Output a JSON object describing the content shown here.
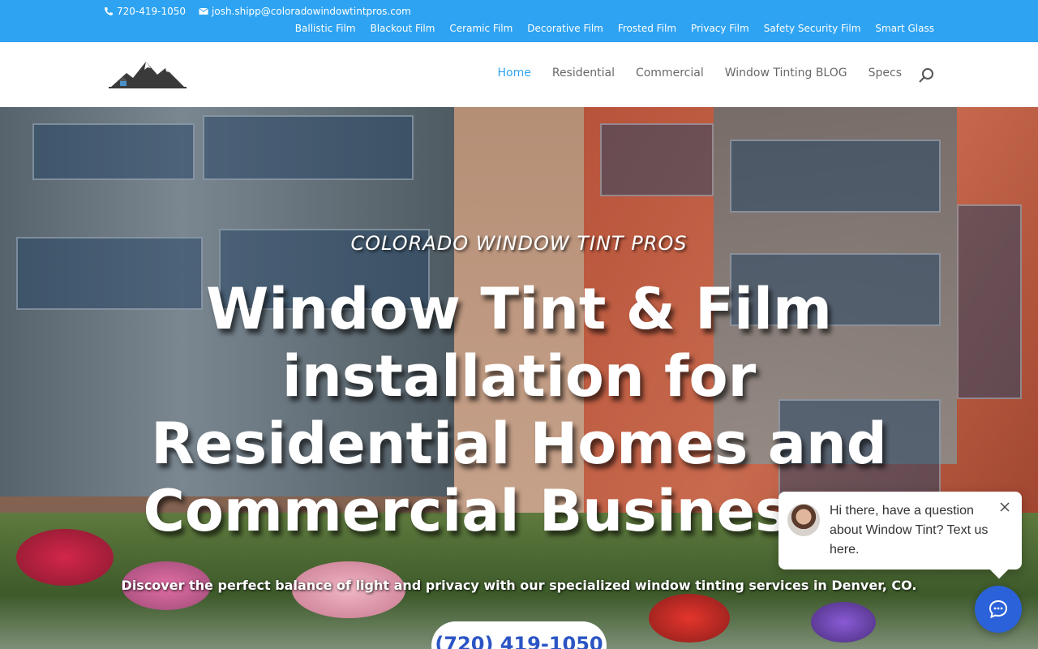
{
  "topbar": {
    "phone": "720-419-1050",
    "email": "josh.shipp@coloradowindowtintpros.com",
    "links": [
      "Ballistic Film",
      "Blackout Film",
      "Ceramic Film",
      "Decorative Film",
      "Frosted Film",
      "Privacy Film",
      "Safety Security Film",
      "Smart Glass"
    ]
  },
  "nav": {
    "items": [
      "Home",
      "Residential",
      "Commercial",
      "Window Tinting BLOG",
      "Specs"
    ],
    "active": "Home"
  },
  "hero": {
    "eyebrow": "COLORADO WINDOW TINT PROS",
    "headline": "Window Tint & Film installation for Residential Homes and Commercial Businesses",
    "subtitle": "Discover the perfect balance of light and privacy with our specialized window tinting services in Denver, CO.",
    "cta": "(720) 419-1050"
  },
  "chat": {
    "message": "Hi there, have a question about Window Tint? Text us here."
  },
  "colors": {
    "topbar": "#2ea3f2",
    "accent": "#2ea3f2",
    "chat_button": "#2b62d9"
  },
  "icons": [
    "phone-icon",
    "email-icon",
    "logo-mountains",
    "search-icon",
    "close-icon",
    "chat-icon"
  ]
}
